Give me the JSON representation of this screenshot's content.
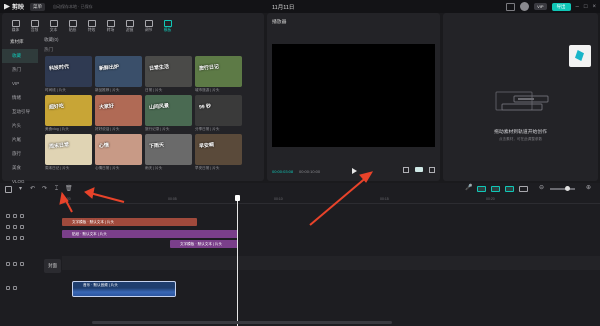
{
  "titlebar": {
    "app_name": "剪映",
    "menu_label": "菜单",
    "autosave": "自动保存本地 · 已保存",
    "title": "11月11日",
    "vip_label": "VIP",
    "export_label": "导出"
  },
  "media": {
    "toolbar": [
      {
        "label": "媒体"
      },
      {
        "label": "音频"
      },
      {
        "label": "文本"
      },
      {
        "label": "贴纸"
      },
      {
        "label": "特效"
      },
      {
        "label": "转场"
      },
      {
        "label": "滤镜"
      },
      {
        "label": "调节"
      },
      {
        "label": "模板"
      }
    ],
    "sidebar": [
      {
        "label": "素材库"
      },
      {
        "label": "收藏"
      },
      {
        "label": "热门"
      },
      {
        "label": "VIP"
      },
      {
        "label": "情绪"
      },
      {
        "label": "互动引导"
      },
      {
        "label": "片头"
      },
      {
        "label": "片尾"
      },
      {
        "label": "旅行"
      },
      {
        "label": "美食"
      },
      {
        "label": "VLOG"
      }
    ],
    "section_title": "收藏(0)",
    "section_sub": "热门",
    "cards": [
      {
        "text": "科技时代",
        "title": "时间线 | 片头",
        "bg": "#2f3a52"
      },
      {
        "text": "新鲜出炉",
        "title": "新品推荐 | 片头",
        "bg": "#3a4f6a"
      },
      {
        "text": "日常生活",
        "title": "日常 | 片头",
        "bg": "#4a4a48"
      },
      {
        "text": "旅行日记",
        "title": "城市旅游 | 片头",
        "bg": "#5d7a46"
      },
      {
        "text": "超好吃",
        "title": "美食vlog | 片头",
        "bg": "#c8a536"
      },
      {
        "text": "大家好",
        "title": "好好说话 | 片头",
        "bg": "#b06a55"
      },
      {
        "text": "山间风景",
        "title": "旅行记录 | 片头",
        "bg": "#4a6a52"
      },
      {
        "text": "99 秒",
        "title": "分享日常 | 片头",
        "bg": "#3a3a3a"
      },
      {
        "text": "周末日常",
        "title": "周末日记 | 片头",
        "bg": "#e0d4b4"
      },
      {
        "text": "心情",
        "title": "心情日常 | 片头",
        "bg": "#c89a86"
      },
      {
        "text": "下雨天",
        "title": "雨天 | 片头",
        "bg": "#6a6a6a"
      },
      {
        "text": "早安啊",
        "title": "早安日常 | 片头",
        "bg": "#5a4a3a"
      }
    ]
  },
  "player": {
    "title": "播放器",
    "timecode_current": "00:00:03:08",
    "timecode_total": "00:00:10:00"
  },
  "properties": {
    "empty_title": "拖动素材到轨道开始创作",
    "empty_sub": "点击素材，可在此调整参数"
  },
  "timeline": {
    "ruler": [
      "00:00",
      "00:05",
      "00:10",
      "00:15",
      "00:20"
    ],
    "cover_label": "封面",
    "clips": [
      {
        "label": "文字模板 · 默认文本 | 片头"
      },
      {
        "label": "贴纸 · 默认文本 | 片头"
      },
      {
        "label": "文字模板 · 默认文本 | 片头"
      }
    ],
    "audio_label": "音乐 · 默认音频 | 片头"
  },
  "colors": {
    "accent": "#10c7b7",
    "annotation_arrow": "#e8432a"
  }
}
